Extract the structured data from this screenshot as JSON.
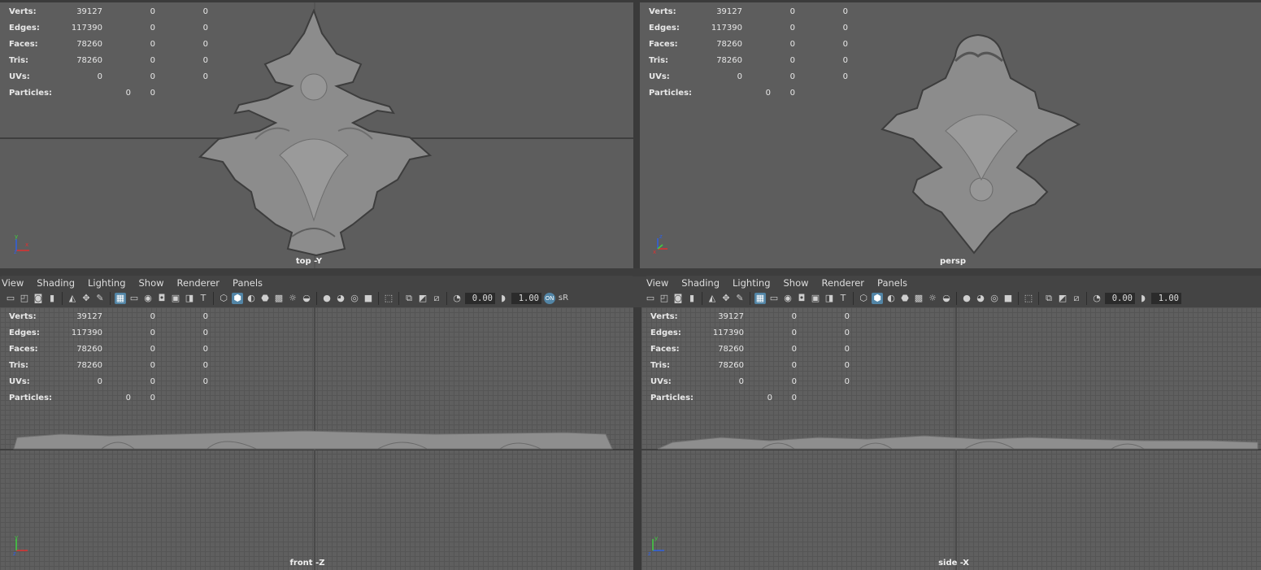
{
  "menus": [
    "View",
    "Shading",
    "Lighting",
    "Show",
    "Renderer",
    "Panels"
  ],
  "hud": {
    "rows": [
      {
        "label": "Verts:",
        "a": "39127",
        "b": "0",
        "c": "0"
      },
      {
        "label": "Edges:",
        "a": "117390",
        "b": "0",
        "c": "0"
      },
      {
        "label": "Faces:",
        "a": "78260",
        "b": "0",
        "c": "0"
      },
      {
        "label": "Tris:",
        "a": "78260",
        "b": "0",
        "c": "0"
      },
      {
        "label": "UVs:",
        "a": "0",
        "b": "0",
        "c": "0"
      },
      {
        "label": "Particles:",
        "a": "0",
        "b": "0",
        "c": ""
      }
    ],
    "rows_persp": [
      {
        "label": "Verts:",
        "a": "39127",
        "b": "0",
        "c": "0"
      },
      {
        "label": "Edges:",
        "a": "117390",
        "b": "0",
        "c": "0"
      },
      {
        "label": "Faces:",
        "a": "78260",
        "b": "0",
        "c": "0"
      },
      {
        "label": "Tris:",
        "a": "78260",
        "b": "0",
        "c": "0"
      },
      {
        "label": "UVs:",
        "a": "0",
        "b": "0",
        "c": "0"
      },
      {
        "label": "Particles:",
        "a": "0",
        "b": "0",
        "c": ""
      }
    ]
  },
  "viewports": {
    "top": {
      "camera": "top -Y"
    },
    "persp": {
      "camera": "persp"
    },
    "front": {
      "camera": "front -Z"
    },
    "side": {
      "camera": "side -X"
    }
  },
  "toolbar": {
    "exposure": "0.00",
    "gamma": "1.00",
    "color_mgmt": "sR"
  },
  "colors": {
    "accent": "#5285a6",
    "viewport_bg": "#5d5d5d",
    "panel_bg": "#444444"
  }
}
